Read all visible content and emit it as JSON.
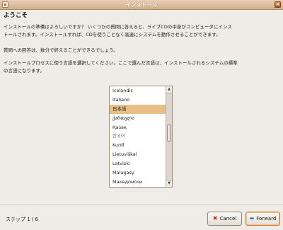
{
  "window": {
    "title": "インストール",
    "close_glyph": "×"
  },
  "page": {
    "heading": "ようこそ",
    "intro_lines": [
      "インストールの準備はよろしいですか？ いくつかの質問に答えると、ライブCDの中身がコンピュータにインス",
      "トールされます。インストールすれば、CDを使うことなく高速にシステムを動作させることができます。"
    ],
    "questions_line": "質問への回答は、数分で終えることができるでしょう。",
    "language_prompt_lines": [
      "インストールプロセスに使う言語を選択してください。ここで選んだ言語は、インストールされるシステムの標準",
      "の言語になります。"
    ]
  },
  "languages": {
    "items": [
      {
        "label": "Icelandic",
        "selected": false
      },
      {
        "label": "Italiano",
        "selected": false
      },
      {
        "label": "日本語",
        "selected": true
      },
      {
        "label": "ქართული",
        "selected": false
      },
      {
        "label": "Қазақ",
        "selected": false
      },
      {
        "label": "한국어",
        "selected": false
      },
      {
        "label": "Kurdî",
        "selected": false
      },
      {
        "label": "Lietuviškai",
        "selected": false
      },
      {
        "label": "Latviski",
        "selected": false
      },
      {
        "label": "Malagasy",
        "selected": false
      },
      {
        "label": "Македонски",
        "selected": false
      }
    ],
    "scroll_position": 0.45,
    "scroll_visible_fraction": 0.2,
    "up_glyph": "▲",
    "down_glyph": "▼"
  },
  "footer": {
    "step_text": "ステップ 1 / 6",
    "cancel_label": "Cancel",
    "cancel_icon": "cancel-x-icon",
    "cancel_glyph": "✖",
    "forward_label": "Forward",
    "forward_icon": "forward-arrow-icon",
    "forward_glyph": "➡"
  },
  "colors": {
    "selection": "#e9bf86",
    "titlebar": "#d2ae8a",
    "default_button_border": "#d17a31"
  }
}
